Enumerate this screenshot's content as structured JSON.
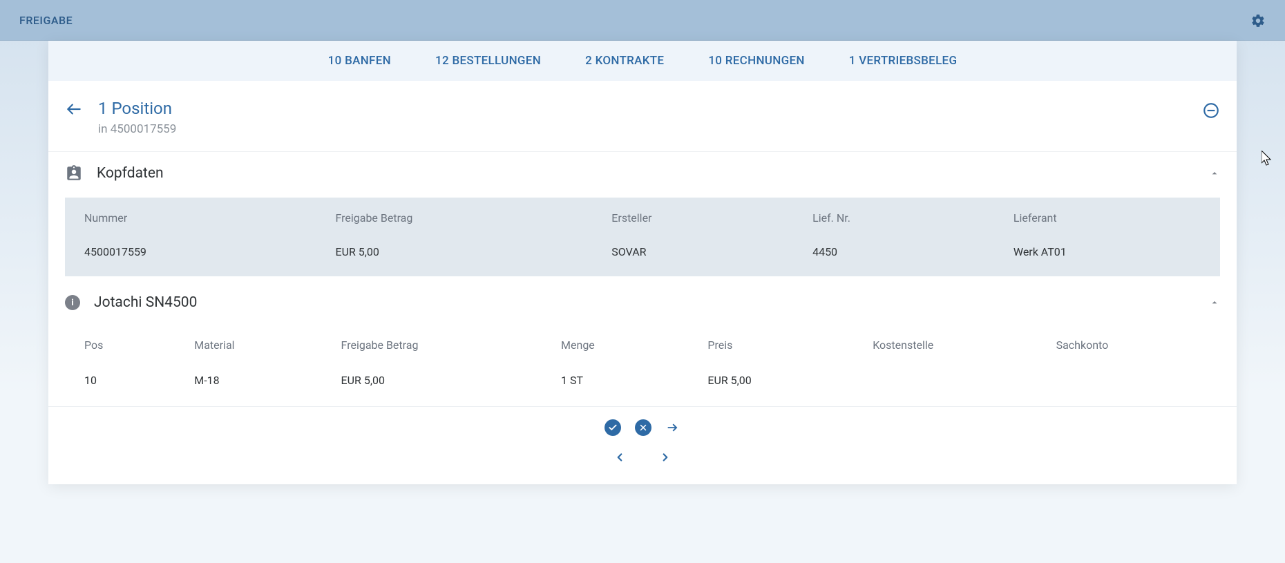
{
  "appbar": {
    "title": "FREIGABE"
  },
  "tabs": [
    "10 BANFEN",
    "12 BESTELLUNGEN",
    "2 KONTRAKTE",
    "10 RECHNUNGEN",
    "1 VERTRIEBSBELEG"
  ],
  "header": {
    "title": "1 Position",
    "subtitle": "in 4500017559"
  },
  "kopfdaten": {
    "section_title": "Kopfdaten",
    "columns": {
      "nummer": "Nummer",
      "freigabe_betrag": "Freigabe Betrag",
      "ersteller": "Ersteller",
      "lief_nr": "Lief. Nr.",
      "lieferant": "Lieferant"
    },
    "row": {
      "nummer": "4500017559",
      "freigabe_betrag": "EUR 5,00",
      "ersteller": "SOVAR",
      "lief_nr": "4450",
      "lieferant": "Werk AT01"
    }
  },
  "position": {
    "section_title": "Jotachi SN4500",
    "columns": {
      "pos": "Pos",
      "material": "Material",
      "freigabe_betrag": "Freigabe Betrag",
      "menge": "Menge",
      "preis": "Preis",
      "kostenstelle": "Kostenstelle",
      "sachkonto": "Sachkonto"
    },
    "row": {
      "pos": "10",
      "material": "M-18",
      "freigabe_betrag": "EUR 5,00",
      "menge": "1 ST",
      "preis": "EUR 5,00",
      "kostenstelle": "",
      "sachkonto": ""
    }
  }
}
